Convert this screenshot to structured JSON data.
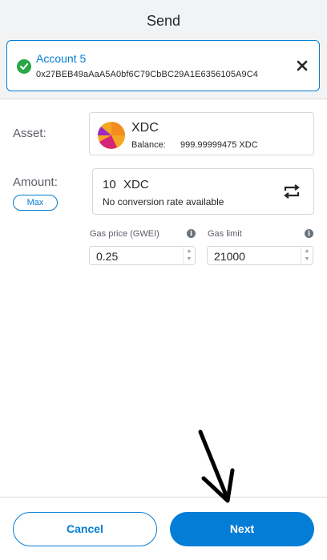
{
  "header": {
    "title": "Send"
  },
  "recipient": {
    "account_name": "Account 5",
    "address": "0x27BEB49aAaA5A0bf6C79CbBC29A1E6356105A9C4"
  },
  "asset": {
    "label": "Asset:",
    "symbol": "XDC",
    "balance_label": "Balance:",
    "balance_value": "999.99999475 XDC"
  },
  "amount": {
    "label": "Amount:",
    "max_label": "Max",
    "value": "10",
    "unit": "XDC",
    "conversion_text": "No conversion rate available"
  },
  "gas": {
    "price_label": "Gas price (GWEI)",
    "price_value": "0.25",
    "limit_label": "Gas limit",
    "limit_value": "21000"
  },
  "footer": {
    "cancel_label": "Cancel",
    "next_label": "Next"
  },
  "colors": {
    "accent": "#037dd6",
    "success": "#28a745",
    "header_bg": "#f2f3f4"
  },
  "icons": {
    "status": "check-circle-icon",
    "close": "close-icon",
    "swap": "swap-icon",
    "info": "info-icon",
    "token": "token-icon"
  }
}
